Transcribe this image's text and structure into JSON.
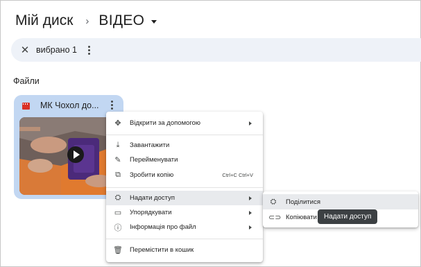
{
  "header": {
    "root": "Мій диск",
    "separator": "›",
    "current": "ВІДЕО"
  },
  "selection_bar": {
    "close_glyph": "✕",
    "count_label": "вибрано 1"
  },
  "files_section": {
    "title": "Файли"
  },
  "file_card": {
    "title": "МК Чохол до...",
    "icon": "video-file-icon",
    "accent_color": "#d93025",
    "card_color": "#c2d7f2"
  },
  "context_menu": {
    "items": [
      {
        "icon": "move-icon",
        "glyph": "✥",
        "label": "Відкрити за допомогою",
        "submenu": true
      },
      {
        "icon": "download-icon",
        "glyph": "⤓",
        "label": "Завантажити"
      },
      {
        "icon": "rename-icon",
        "glyph": "✎",
        "label": "Перейменувати"
      },
      {
        "icon": "copy-icon",
        "glyph": "⧉",
        "label": "Зробити копію",
        "shortcut": "Ctrl+C Ctrl+V"
      },
      {
        "icon": "share-icon",
        "glyph": "⛭",
        "label": "Надати доступ",
        "submenu": true,
        "highlighted": true
      },
      {
        "icon": "folder-icon",
        "glyph": "▭",
        "label": "Упорядкувати",
        "submenu": true
      },
      {
        "icon": "info-icon",
        "glyph": "ⓘ",
        "label": "Інформація про файл",
        "submenu": true
      },
      {
        "icon": "trash-icon",
        "glyph": "🗑",
        "label": "Перемістити в кошик"
      }
    ]
  },
  "share_submenu": {
    "items": [
      {
        "icon": "person-add-icon",
        "glyph": "⛭",
        "label": "Поділитися",
        "highlighted": true
      },
      {
        "icon": "link-icon",
        "glyph": "⊂⊃",
        "label": "Копіювати"
      }
    ]
  },
  "tooltip": {
    "text": "Надати доступ"
  },
  "colors": {
    "selection_bar": "#eef2f8",
    "menu_highlight": "#e8eaed",
    "tooltip_bg": "#3c4043"
  }
}
